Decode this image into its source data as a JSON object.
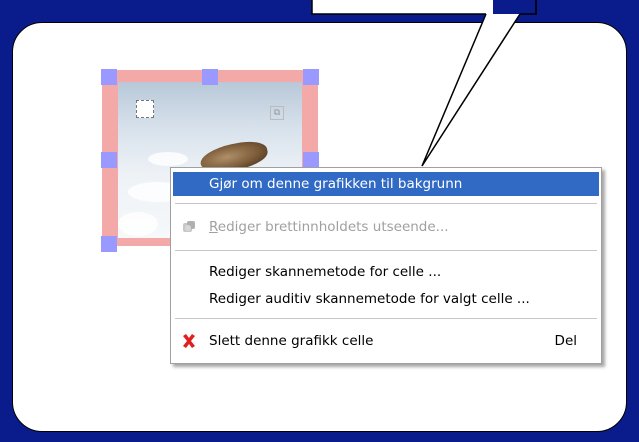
{
  "menu": {
    "items": [
      {
        "label": "Gjør om denne grafikken til bakgrunn",
        "state": "highlighted"
      },
      {
        "label": "Rediger brettinnholdets utseende...",
        "state": "disabled",
        "icon": "paint-icon"
      },
      {
        "label": "Rediger skannemetode for celle ...",
        "state": "normal"
      },
      {
        "label": "Rediger auditiv skannemetode for valgt celle ...",
        "state": "normal"
      },
      {
        "label": "Slett denne grafikk celle",
        "shortcut": "Del",
        "state": "normal",
        "icon": "delete-x-icon"
      }
    ]
  },
  "colors": {
    "frame": "#0a1c8c",
    "selection": "#316ac5",
    "cell_border": "#f4a9a9",
    "handle": "#9999ff",
    "delete_icon": "#e02020"
  }
}
